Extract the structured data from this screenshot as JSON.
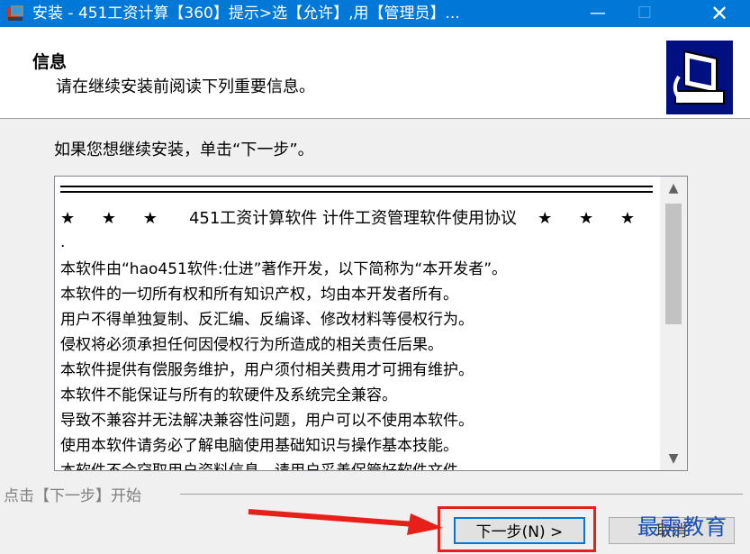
{
  "window": {
    "title": "安装 - 451工资计算【360】提示>选【允许】,用【管理员】...",
    "minimize_glyph": "—",
    "maximize_glyph": "☐",
    "close_glyph": "✕"
  },
  "header": {
    "title": "信息",
    "subtitle": "请在继续安装前阅读下列重要信息。"
  },
  "prompt": "如果您想继续安装，单击“下一步”。",
  "license": {
    "heading_stars_left": "★ ★ ★",
    "heading": "451工资计算软件 计件工资管理软件使用协议",
    "heading_stars_right": "★ ★ ★",
    "dot": ".",
    "lines": [
      "本软件由“hao451软件:仕进”著作开发，以下简称为“本开发者”。",
      "本软件的一切所有权和所有知识产权，均由本开发者所有。",
      "用户不得单独复制、反汇编、反编译、修改材料等侵权行为。",
      "侵权将必须承担任何因侵权行为所造成的相关责任后果。",
      "本软件提供有偿服务维护，用户须付相关费用才可拥有维护。",
      "本软件不能保证与所有的软硬件及系统完全兼容。",
      "导致不兼容并无法解决兼容性问题，用户可以不使用本软件。",
      "使用本软件请务必了解电脑使用基础知识与操作基本技能。",
      "本软件不会窃取用户资料信息，请用户妥善保管好软件文件。"
    ]
  },
  "status_text": "点击【下一步】开始",
  "buttons": {
    "next": "下一步(N) >",
    "cancel": "取消"
  },
  "watermark": "最需教育",
  "icons": {
    "app": "installer-icon",
    "scroll_up": "▲",
    "scroll_down": "▼"
  },
  "colors": {
    "titlebar": "#0078d7",
    "highlight": "#e8201a",
    "watermark": "#1a4fb5"
  }
}
